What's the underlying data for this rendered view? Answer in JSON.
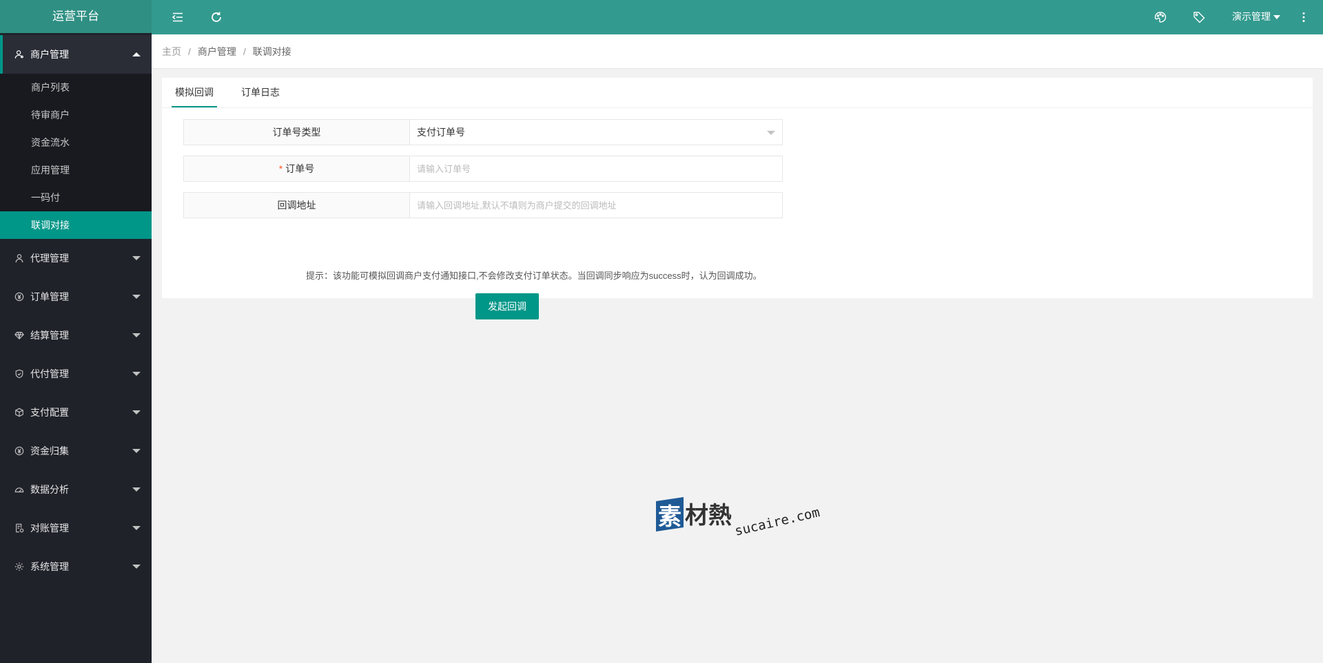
{
  "sidebar": {
    "title": "运营平台",
    "groups": [
      {
        "label": "商户管理",
        "icon": "user-icon",
        "expanded": true,
        "items": [
          "商户列表",
          "待审商户",
          "资金流水",
          "应用管理",
          "一码付",
          "联调对接"
        ],
        "active_item": "联调对接"
      },
      {
        "label": "代理管理",
        "icon": "user-outline-icon"
      },
      {
        "label": "订单管理",
        "icon": "yen-circle-icon"
      },
      {
        "label": "结算管理",
        "icon": "diamond-icon"
      },
      {
        "label": "代付管理",
        "icon": "shield-check-icon"
      },
      {
        "label": "支付配置",
        "icon": "cube-icon"
      },
      {
        "label": "资金归集",
        "icon": "yen-circle-icon"
      },
      {
        "label": "数据分析",
        "icon": "dashboard-icon"
      },
      {
        "label": "对账管理",
        "icon": "document-check-icon"
      },
      {
        "label": "系统管理",
        "icon": "gear-icon"
      }
    ]
  },
  "header": {
    "user_label": "演示管理",
    "icons": [
      "menu-fold-icon",
      "refresh-icon",
      "palette-icon",
      "tag-icon",
      "more-vertical-icon"
    ]
  },
  "breadcrumb": [
    "主页",
    "商户管理",
    "联调对接"
  ],
  "tabs": [
    "模拟回调",
    "订单日志"
  ],
  "active_tab": "模拟回调",
  "form": {
    "order_type_label": "订单号类型",
    "order_type_value": "支付订单号",
    "order_no_label": "订单号",
    "order_no_required": "*",
    "order_no_placeholder": "请输入订单号",
    "callback_url_label": "回调地址",
    "callback_url_placeholder": "请输入回调地址,默认不填则为商户提交的回调地址",
    "tip": "提示：该功能可模拟回调商户支付通知接口,不会修改支付订单状态。当回调同步响应为success时，认为回调成功。",
    "submit_label": "发起回调"
  },
  "watermark": {
    "brand": "素材熱",
    "domain": "sucaire.com"
  },
  "colors": {
    "primary": "#009688",
    "header": "#339a8f",
    "sidebar": "#20222a"
  }
}
